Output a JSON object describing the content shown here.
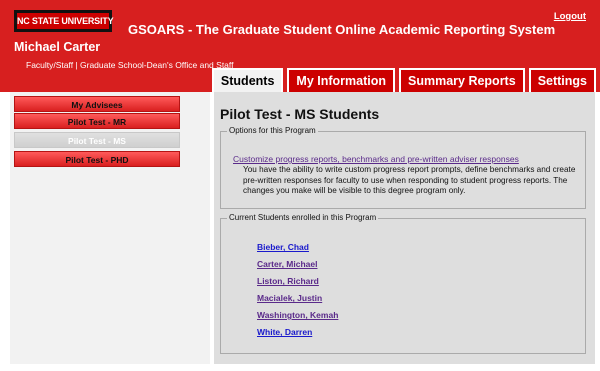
{
  "header": {
    "logo_text": "NC STATE UNIVERSITY",
    "app_title": "GSOARS - The Graduate Student Online Academic Reporting System",
    "logout_label": "Logout",
    "user_name": "Michael Carter",
    "user_role": "Faculty/Staff | Graduate School-Dean's Office and Staff"
  },
  "tabs": [
    {
      "label": "Students",
      "active": true
    },
    {
      "label": "My Information",
      "active": false
    },
    {
      "label": "Summary Reports",
      "active": false
    },
    {
      "label": "Settings",
      "active": false
    }
  ],
  "sidebar": {
    "items": [
      {
        "label": "My Advisees",
        "selected": false
      },
      {
        "label": "Pilot Test - MR",
        "selected": false
      },
      {
        "label": "Pilot Test - MS",
        "selected": true
      },
      {
        "label": "Pilot Test - PHD",
        "selected": false
      }
    ]
  },
  "main": {
    "title": "Pilot Test - MS Students",
    "options": {
      "legend": "Options for this Program",
      "link_text": "Customize progress reports, benchmarks and pre-written adviser responses",
      "description": "You have the ability to write custom progress report prompts, define benchmarks and create pre-written responses for faculty to use when responding to student progress reports. The changes you make will be visible to this degree program only."
    },
    "students": {
      "legend": "Current Students enrolled in this Program",
      "list": [
        {
          "name": "Bieber, Chad",
          "visited": false
        },
        {
          "name": "Carter, Michael",
          "visited": true
        },
        {
          "name": "Liston, Richard",
          "visited": true
        },
        {
          "name": "Macialek, Justin",
          "visited": true
        },
        {
          "name": "Washington, Kemah",
          "visited": true
        },
        {
          "name": "White, Darren",
          "visited": false
        }
      ]
    }
  },
  "colors": {
    "brand_red": "#d71f1f",
    "content_gray": "#dedede",
    "visited_link": "#5a2a8a",
    "link": "#1a1acc"
  }
}
